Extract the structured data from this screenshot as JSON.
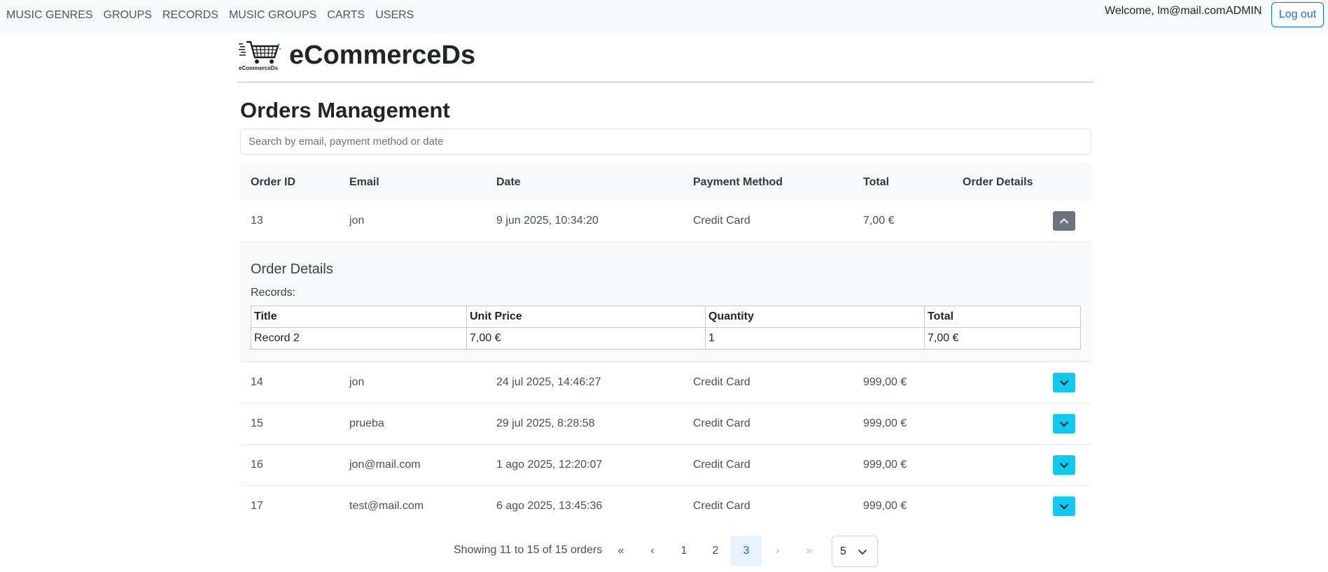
{
  "nav": {
    "links": [
      "MUSIC GENRES",
      "GROUPS",
      "RECORDS",
      "MUSIC GROUPS",
      "CARTS",
      "USERS"
    ],
    "welcome": "Welcome, lm@mail.com",
    "role": "ADMIN",
    "logout_label": "Log out"
  },
  "brand": {
    "name": "eCommerceDs",
    "logo_text": "eCommerceDs"
  },
  "page": {
    "title": "Orders Management",
    "search_placeholder": "Search by email, payment method or date"
  },
  "orders_table": {
    "headers": [
      "Order ID",
      "Email",
      "Date",
      "Payment Method",
      "Total",
      "Order Details"
    ],
    "rows": [
      {
        "id": "13",
        "email": "jon",
        "date": "9 jun 2025, 10:34:20",
        "payment": "Credit Card",
        "total": "7,00 €",
        "expanded": true
      },
      {
        "id": "14",
        "email": "jon",
        "date": "24 jul 2025, 14:46:27",
        "payment": "Credit Card",
        "total": "999,00 €",
        "expanded": false
      },
      {
        "id": "15",
        "email": "prueba",
        "date": "29 jul 2025, 8:28:58",
        "payment": "Credit Card",
        "total": "999,00 €",
        "expanded": false
      },
      {
        "id": "16",
        "email": "jon@mail.com",
        "date": "1 ago 2025, 12:20:07",
        "payment": "Credit Card",
        "total": "999,00 €",
        "expanded": false
      },
      {
        "id": "17",
        "email": "test@mail.com",
        "date": "6 ago 2025, 13:45:36",
        "payment": "Credit Card",
        "total": "999,00 €",
        "expanded": false
      }
    ]
  },
  "order_details": {
    "title": "Order Details",
    "subtitle": "Records:",
    "headers": [
      "Title",
      "Unit Price",
      "Quantity",
      "Total"
    ],
    "rows": [
      {
        "title": "Record 2",
        "unit_price": "7,00 €",
        "quantity": "1",
        "total": "7,00 €"
      }
    ]
  },
  "pagination": {
    "showing": "Showing 11 to 15 of 15 orders",
    "first": "«",
    "prev": "‹",
    "pages": [
      "1",
      "2",
      "3"
    ],
    "current_page": "3",
    "next": "›",
    "last": "»",
    "page_size": "5"
  },
  "colors": {
    "primary": "#0d6efd",
    "info": "#0dcaf0",
    "secondary": "#6c757d",
    "navbar_bg": "#f8f9fa"
  },
  "icons": {
    "expand": "chevron-down-icon",
    "collapse": "chevron-up-icon",
    "select": "chevron-down-icon"
  }
}
